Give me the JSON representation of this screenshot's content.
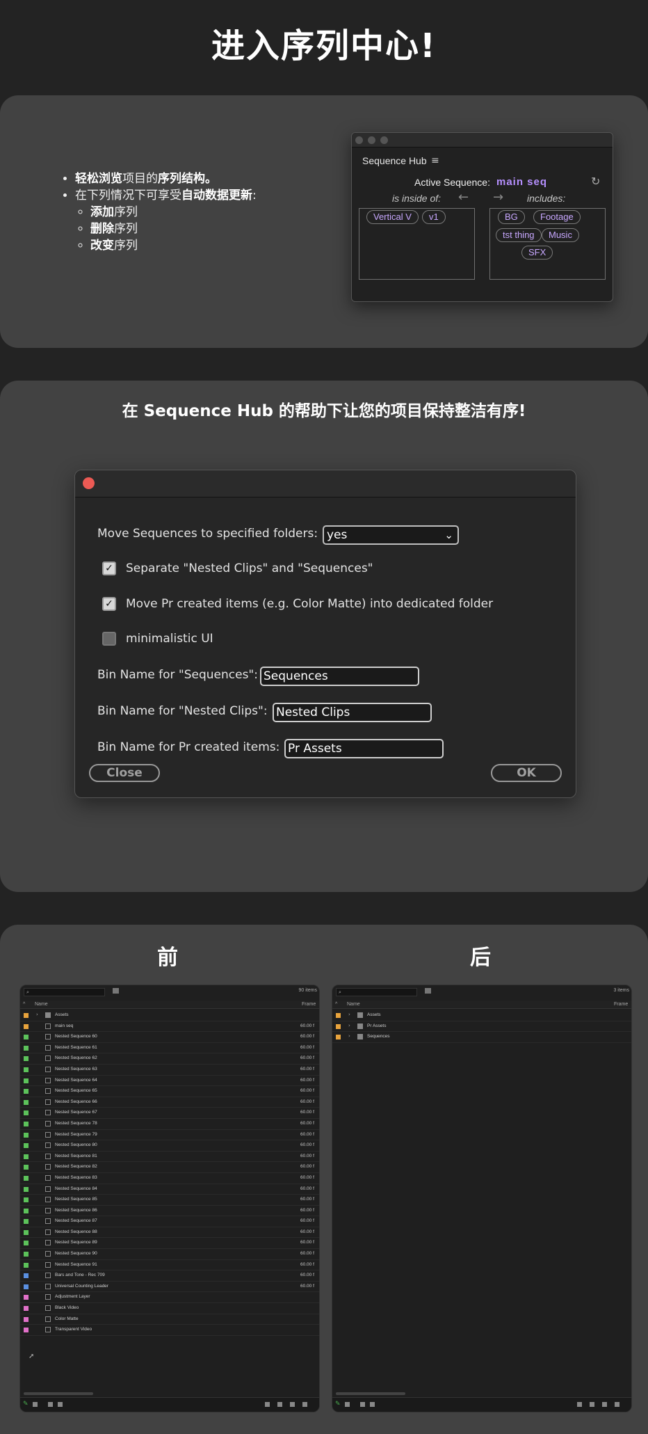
{
  "page_title": "进入序列中心!",
  "card1": {
    "bullets": [
      {
        "bold": "轻松浏览",
        "normal": "项目的",
        "bold2": "序列结构。"
      },
      {
        "normal": "在下列情况下可享受",
        "bold": "自动数据更新",
        "normal2": ":"
      }
    ],
    "sub_bullets": [
      {
        "bold": "添加",
        "normal": "序列"
      },
      {
        "bold": "删除",
        "normal": "序列"
      },
      {
        "bold": "改变",
        "normal": "序列"
      }
    ],
    "hub": {
      "tab_title": "Sequence Hub",
      "menu_icon": "≡",
      "active_label": "Active Sequence:",
      "active_value": "main seq",
      "refresh_icon": "↻",
      "inside_label": "is inside of:",
      "arrow_left": "←",
      "arrow_right": "→",
      "includes_label": "includes:",
      "inside_chips": [
        "Vertical V",
        "v1"
      ],
      "include_chips": [
        "BG",
        "Footage",
        "tst thing",
        "Music",
        "SFX"
      ],
      "accent": "#b690ff"
    }
  },
  "card2": {
    "heading": "在 Sequence Hub 的帮助下让您的项目保持整洁有序!",
    "dialog": {
      "move_label": "Move Sequences to specified folders:",
      "move_value": "yes",
      "check1": "Separate \"Nested Clips\" and \"Sequences\"",
      "check2": "Move Pr created items (e.g. Color Matte) into dedicated folder",
      "check3": "minimalistic UI",
      "bin_seq_label": "Bin Name for \"Sequences\":",
      "bin_seq_value": "Sequences",
      "bin_nested_label": "Bin Name for \"Nested Clips\":",
      "bin_nested_value": "Nested Clips",
      "bin_pr_label": "Bin Name for Pr created items:",
      "bin_pr_value": "Pr Assets",
      "close_label": "Close",
      "ok_label": "OK",
      "check_mark": "✓"
    }
  },
  "card3": {
    "before_label": "前",
    "after_label": "后",
    "before": {
      "count": "90 items",
      "col_name": "Name",
      "col_frame": "Frame",
      "rows": [
        {
          "name": "Assets",
          "color": "#e8a33c",
          "kind": "folder",
          "frame": ""
        },
        {
          "name": "main seq",
          "color": "#e8a33c",
          "kind": "seq",
          "frame": "60.00 f"
        },
        {
          "name": "Nested Sequence 60",
          "color": "#5cc25a",
          "kind": "seq",
          "frame": "60.00 f"
        },
        {
          "name": "Nested Sequence 61",
          "color": "#5cc25a",
          "kind": "seq",
          "frame": "60.00 f"
        },
        {
          "name": "Nested Sequence 62",
          "color": "#5cc25a",
          "kind": "seq",
          "frame": "60.00 f"
        },
        {
          "name": "Nested Sequence 63",
          "color": "#5cc25a",
          "kind": "seq",
          "frame": "60.00 f"
        },
        {
          "name": "Nested Sequence 64",
          "color": "#5cc25a",
          "kind": "seq",
          "frame": "60.00 f"
        },
        {
          "name": "Nested Sequence 65",
          "color": "#5cc25a",
          "kind": "seq",
          "frame": "60.00 f"
        },
        {
          "name": "Nested Sequence 66",
          "color": "#5cc25a",
          "kind": "seq",
          "frame": "60.00 f"
        },
        {
          "name": "Nested Sequence 67",
          "color": "#5cc25a",
          "kind": "seq",
          "frame": "60.00 f"
        },
        {
          "name": "Nested Sequence 78",
          "color": "#5cc25a",
          "kind": "seq",
          "frame": "60.00 f"
        },
        {
          "name": "Nested Sequence 79",
          "color": "#5cc25a",
          "kind": "seq",
          "frame": "60.00 f"
        },
        {
          "name": "Nested Sequence 80",
          "color": "#5cc25a",
          "kind": "seq",
          "frame": "60.00 f"
        },
        {
          "name": "Nested Sequence 81",
          "color": "#5cc25a",
          "kind": "seq",
          "frame": "60.00 f"
        },
        {
          "name": "Nested Sequence 82",
          "color": "#5cc25a",
          "kind": "seq",
          "frame": "60.00 f"
        },
        {
          "name": "Nested Sequence 83",
          "color": "#5cc25a",
          "kind": "seq",
          "frame": "60.00 f"
        },
        {
          "name": "Nested Sequence 84",
          "color": "#5cc25a",
          "kind": "seq",
          "frame": "60.00 f"
        },
        {
          "name": "Nested Sequence 85",
          "color": "#5cc25a",
          "kind": "seq",
          "frame": "60.00 f"
        },
        {
          "name": "Nested Sequence 86",
          "color": "#5cc25a",
          "kind": "seq",
          "frame": "60.00 f"
        },
        {
          "name": "Nested Sequence 87",
          "color": "#5cc25a",
          "kind": "seq",
          "frame": "60.00 f"
        },
        {
          "name": "Nested Sequence 88",
          "color": "#5cc25a",
          "kind": "seq",
          "frame": "60.00 f"
        },
        {
          "name": "Nested Sequence 89",
          "color": "#5cc25a",
          "kind": "seq",
          "frame": "60.00 f"
        },
        {
          "name": "Nested Sequence 90",
          "color": "#5cc25a",
          "kind": "seq",
          "frame": "60.00 f"
        },
        {
          "name": "Nested Sequence 91",
          "color": "#5cc25a",
          "kind": "seq",
          "frame": "60.00 f"
        },
        {
          "name": "Bars and Tone - Rec 709",
          "color": "#5a8fe0",
          "kind": "seq",
          "frame": "60.00 f"
        },
        {
          "name": "Universal Counting Leader",
          "color": "#5a8fe0",
          "kind": "seq",
          "frame": "60.00 f"
        },
        {
          "name": "Adjustment Layer",
          "color": "#e070c8",
          "kind": "item",
          "frame": ""
        },
        {
          "name": "Black Video",
          "color": "#e070c8",
          "kind": "item",
          "frame": ""
        },
        {
          "name": "Color Matte",
          "color": "#e070c8",
          "kind": "item",
          "frame": ""
        },
        {
          "name": "Transparent Video",
          "color": "#e070c8",
          "kind": "item",
          "frame": ""
        }
      ]
    },
    "after": {
      "count": "3 items",
      "col_name": "Name",
      "col_frame": "Frame",
      "rows": [
        {
          "name": "Assets",
          "color": "#e8a33c",
          "kind": "folder",
          "frame": ""
        },
        {
          "name": "Pr Assets",
          "color": "#e8a33c",
          "kind": "folder",
          "frame": ""
        },
        {
          "name": "Sequences",
          "color": "#e8a33c",
          "kind": "folder",
          "frame": ""
        }
      ]
    }
  }
}
